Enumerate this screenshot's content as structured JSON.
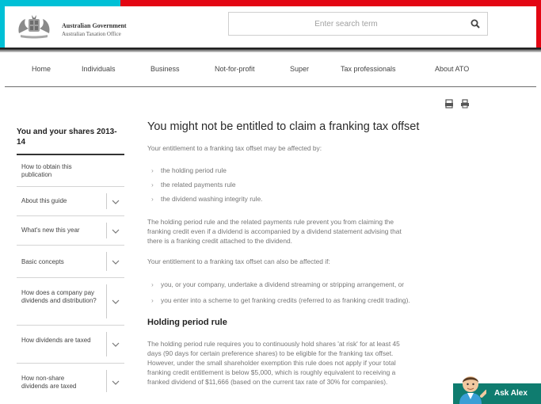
{
  "header": {
    "gov_line1": "Australian Government",
    "gov_line2": "Australian Taxation Office",
    "search_placeholder": "Enter search term"
  },
  "nav": {
    "items": [
      "Home",
      "Individuals",
      "Business",
      "Not-for-profit",
      "Super",
      "Tax professionals",
      "About ATO"
    ]
  },
  "sidebar": {
    "title": "You and your shares 2013-14",
    "items": [
      {
        "label": "How to obtain this publication",
        "expandable": false
      },
      {
        "label": "About this guide",
        "expandable": true
      },
      {
        "label": "What's new this year",
        "expandable": true
      },
      {
        "label": "Basic concepts",
        "expandable": true
      },
      {
        "label": "How does a company pay dividends and distribution?",
        "expandable": true
      },
      {
        "label": "How dividends are taxed",
        "expandable": true
      },
      {
        "label": "How non-share dividends are taxed",
        "expandable": true
      }
    ]
  },
  "main": {
    "title": "You might not be entitled to claim a franking tax offset",
    "intro": "Your entitlement to a franking tax offset may be affected by:",
    "bullets1": [
      "the holding period rule",
      "the related payments rule",
      "the dividend washing integrity rule."
    ],
    "para1_lines": [
      "The holding period rule and the related payments rule prevent you from claiming the",
      "franking credit even if a dividend is accompanied by a dividend statement advising that",
      "there is a franking credit attached to the dividend."
    ],
    "para2": "Your entitlement to a franking tax offset can also be affected if:",
    "bullets2": [
      "you, or your company, undertake a dividend streaming or stripping arrangement, or",
      "you enter into a scheme to get franking credits (referred to as franking credit trading)."
    ],
    "subheading": "Holding period rule",
    "para3_lines": [
      "The holding period rule requires you to continuously hold shares 'at risk' for at least 45",
      "days (90 days for certain preference shares) to be eligible for the franking tax offset.",
      "However, under the small shareholder exemption this rule does not apply if your total",
      "franking credit entitlement is below $5,000, which is roughly equivalent to receiving a",
      "franked dividend of $11,666 (based on the current tax rate of 30% for companies)."
    ]
  },
  "chat": {
    "label": "Ask Alex"
  },
  "colors": {
    "red": "#e30613",
    "cyan": "#00c0d6",
    "teal": "#0f7c6f"
  }
}
